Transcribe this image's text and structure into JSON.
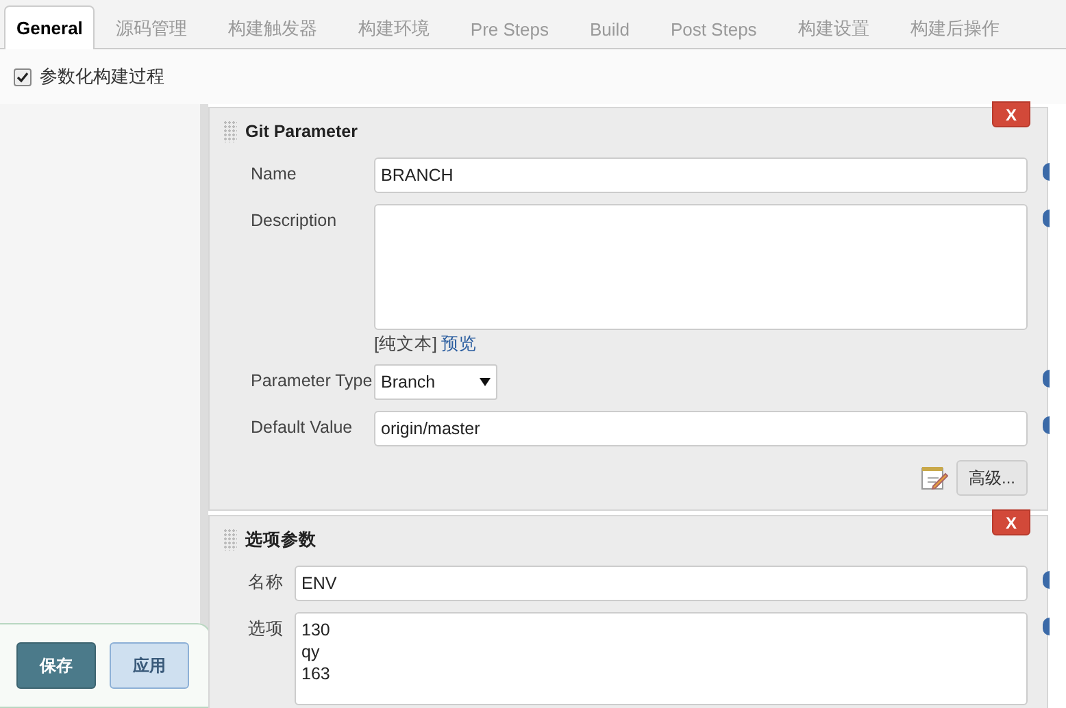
{
  "tabs": [
    {
      "label": "General",
      "selected": true
    },
    {
      "label": "源码管理",
      "selected": false
    },
    {
      "label": "构建触发器",
      "selected": false
    },
    {
      "label": "构建环境",
      "selected": false
    },
    {
      "label": "Pre Steps",
      "selected": false
    },
    {
      "label": "Build",
      "selected": false
    },
    {
      "label": "Post Steps",
      "selected": false
    },
    {
      "label": "构建设置",
      "selected": false
    },
    {
      "label": "构建后操作",
      "selected": false
    }
  ],
  "parameterized": {
    "label": "参数化构建过程",
    "checked": true
  },
  "panels": [
    {
      "title": "Git Parameter",
      "close": "X",
      "kind": "git",
      "fields": [
        {
          "kind": "text",
          "label": "Name",
          "value": "BRANCH"
        },
        {
          "kind": "textarea",
          "label": "Description",
          "format": "[纯文本]",
          "preview": "预览"
        },
        {
          "kind": "select",
          "label": "Parameter Type",
          "value": "Branch"
        },
        {
          "kind": "text",
          "label": "Default Value",
          "value": "origin/master"
        }
      ],
      "advanced": "高级..."
    },
    {
      "title": "选项参数",
      "close": "X",
      "kind": "choice",
      "fields": [
        {
          "kind": "text",
          "label": "名称",
          "value": "ENV"
        },
        {
          "kind": "textarea",
          "label": "选项",
          "value": "130\nqy\n163"
        }
      ]
    }
  ],
  "buttons": [
    {
      "label": "保存",
      "kind": "primary"
    },
    {
      "label": "应用",
      "kind": "secondary"
    }
  ]
}
